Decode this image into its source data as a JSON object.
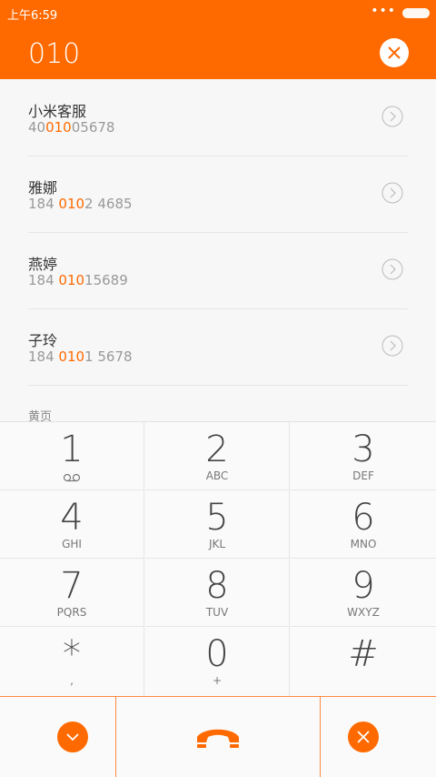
{
  "status": {
    "time": "上午6:59",
    "dots": "•••"
  },
  "search": {
    "query": "010"
  },
  "contacts": [
    {
      "name": "小米客服",
      "pre": "40",
      "hl": "010",
      "post": "05678"
    },
    {
      "name": "雅娜",
      "pre": "184 ",
      "hl": "010",
      "post": "2 4685"
    },
    {
      "name": "燕婷",
      "pre": "184 ",
      "hl": "010",
      "post": "15689"
    },
    {
      "name": "子玲",
      "pre": "184 ",
      "hl": "010",
      "post": "1 5678"
    }
  ],
  "section_label": "黄页",
  "keys": [
    {
      "digit": "1",
      "letters": ""
    },
    {
      "digit": "2",
      "letters": "ABC"
    },
    {
      "digit": "3",
      "letters": "DEF"
    },
    {
      "digit": "4",
      "letters": "GHI"
    },
    {
      "digit": "5",
      "letters": "JKL"
    },
    {
      "digit": "6",
      "letters": "MNO"
    },
    {
      "digit": "7",
      "letters": "PQRS"
    },
    {
      "digit": "8",
      "letters": "TUV"
    },
    {
      "digit": "9",
      "letters": "WXYZ"
    },
    {
      "digit": "*",
      "letters": ","
    },
    {
      "digit": "0",
      "letters": "+"
    },
    {
      "digit": "#",
      "letters": ""
    }
  ],
  "icons": {
    "clear": "close-icon",
    "voicemail": "voicemail-icon",
    "collapse": "chevron-down-icon",
    "call": "phone-icon",
    "delete": "close-icon"
  },
  "colors": {
    "accent": "#ff6a00",
    "background": "#f7f7f7"
  }
}
